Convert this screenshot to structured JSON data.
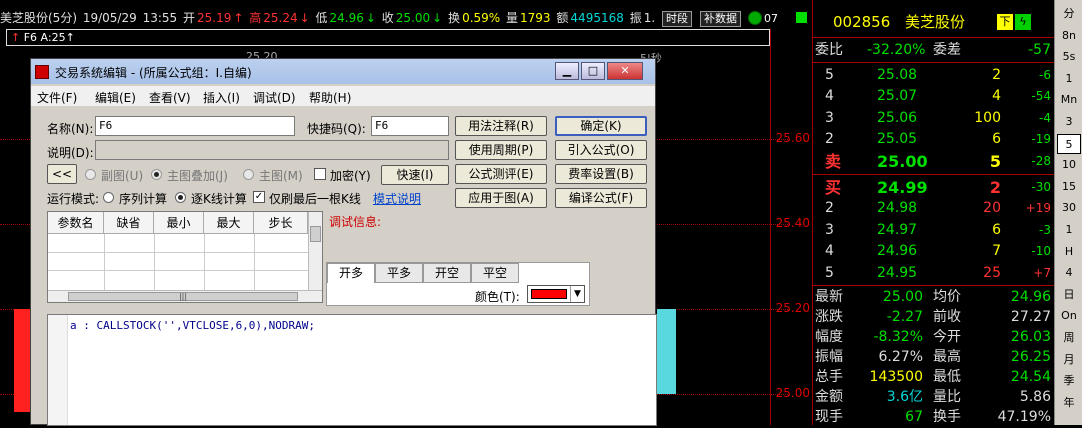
{
  "header": {
    "stock": "美芝股份(5分)",
    "date": "19/05/29",
    "time": "13:55",
    "open_label": "开",
    "open": "25.19",
    "high_label": "高",
    "high": "25.24",
    "low_label": "低",
    "low": "24.96",
    "close_label": "收",
    "close": "25.00",
    "turnover_label": "换",
    "turnover": "0.59%",
    "volume_label": "量",
    "volume": "1793",
    "amount_label": "额",
    "amount": "4495168",
    "amplitude_label": "振",
    "amplitude": "1.",
    "btn_period": "时段",
    "btn_supplement": "补数据",
    "formula_line": "F6 A:25",
    "clipped_text": "07",
    "chart_hint": "5|秒",
    "overlap_text": "25.20"
  },
  "chart": {
    "price_labels": [
      "25.60",
      "25.40",
      "25.20",
      "25.00"
    ]
  },
  "dialog": {
    "title": "交易系统编辑 - (所属公式组：I.自编)",
    "menu": [
      "文件(F)",
      "编辑(E)",
      "查看(V)",
      "插入(I)",
      "调试(D)",
      "帮助(H)"
    ],
    "name_label": "名称(N):",
    "name_value": "F6",
    "shortcut_label": "快捷码(Q):",
    "shortcut_value": "F6",
    "desc_label": "说明(D):",
    "desc_value": "",
    "collapse": "<<",
    "mode_sub": "副图(U)",
    "mode_main_overlay": "主图叠加(J)",
    "mode_main": "主图(M)",
    "encrypt": "加密(Y)",
    "quick": "快速(I)",
    "run_mode_label": "运行模式:",
    "run_sequence": "序列计算",
    "run_kline": "逐K线计算",
    "last_kline_only": "仅刷最后一根K线",
    "mode_help": "模式说明",
    "param_headers": [
      "参数名",
      "缺省",
      "最小",
      "最大",
      "步长"
    ],
    "debug_label": "调试信息:",
    "tabs": [
      "开多",
      "平多",
      "开空",
      "平空"
    ],
    "color_label": "颜色(T):",
    "color_value": "#ff0000",
    "buttons_left": [
      "用法注释(R)",
      "使用周期(P)",
      "公式测评(E)",
      "应用于图(A)"
    ],
    "buttons_right": [
      "确定(K)",
      "引入公式(O)",
      "费率设置(B)",
      "编译公式(F)"
    ],
    "code": "a : CALLSTOCK('',VTCLOSE,6,0),NODRAW;"
  },
  "panel": {
    "code": "002856",
    "name": "美芝股份",
    "btn_down": "下",
    "btn_lightning": "ϟ",
    "webi_label": "委比",
    "webi": "-32.20%",
    "weicha_label": "委差",
    "weicha": "-57",
    "asks": [
      {
        "level": "5",
        "price": "25.08",
        "vol": "2",
        "chg": "-6"
      },
      {
        "level": "4",
        "price": "25.07",
        "vol": "4",
        "chg": "-54"
      },
      {
        "level": "3",
        "price": "25.06",
        "vol": "100",
        "chg": "-4"
      },
      {
        "level": "2",
        "price": "25.05",
        "vol": "6",
        "chg": "-19"
      },
      {
        "level": "卖",
        "price": "25.00",
        "vol": "5",
        "chg": "-28"
      }
    ],
    "bids": [
      {
        "level": "买",
        "price": "24.99",
        "vol": "2",
        "chg": "-30"
      },
      {
        "level": "2",
        "price": "24.98",
        "vol": "20",
        "chg": "+19"
      },
      {
        "level": "3",
        "price": "24.97",
        "vol": "6",
        "chg": "-3"
      },
      {
        "level": "4",
        "price": "24.96",
        "vol": "7",
        "chg": "-10"
      },
      {
        "level": "5",
        "price": "24.95",
        "vol": "25",
        "chg": "+7"
      }
    ],
    "stats": [
      {
        "l1": "最新",
        "v1": "25.00",
        "l2": "均价",
        "v2": "24.96"
      },
      {
        "l1": "涨跌",
        "v1": "-2.27",
        "l2": "前收",
        "v2": "27.27"
      },
      {
        "l1": "幅度",
        "v1": "-8.32%",
        "l2": "今开",
        "v2": "26.03"
      },
      {
        "l1": "振幅",
        "v1": "6.27%",
        "l2": "最高",
        "v2": "26.25"
      },
      {
        "l1": "总手",
        "v1": "143500",
        "l2": "最低",
        "v2": "24.54"
      },
      {
        "l1": "金额",
        "v1": "3.6亿",
        "l2": "量比",
        "v2": "5.86"
      },
      {
        "l1": "现手",
        "v1": "67",
        "l2": "换手",
        "v2": "47.19%"
      }
    ]
  },
  "sidebar": [
    "分",
    "8n",
    "5s",
    "1",
    "Mn",
    "3",
    "5",
    "10",
    "15",
    "30",
    "1",
    "H",
    "4",
    "日",
    "On",
    "周",
    "月",
    "季",
    "年"
  ],
  "colors": {
    "red": "#ff3232",
    "green": "#00e000",
    "yellow": "#ffff00",
    "cyan": "#00d8d8"
  }
}
